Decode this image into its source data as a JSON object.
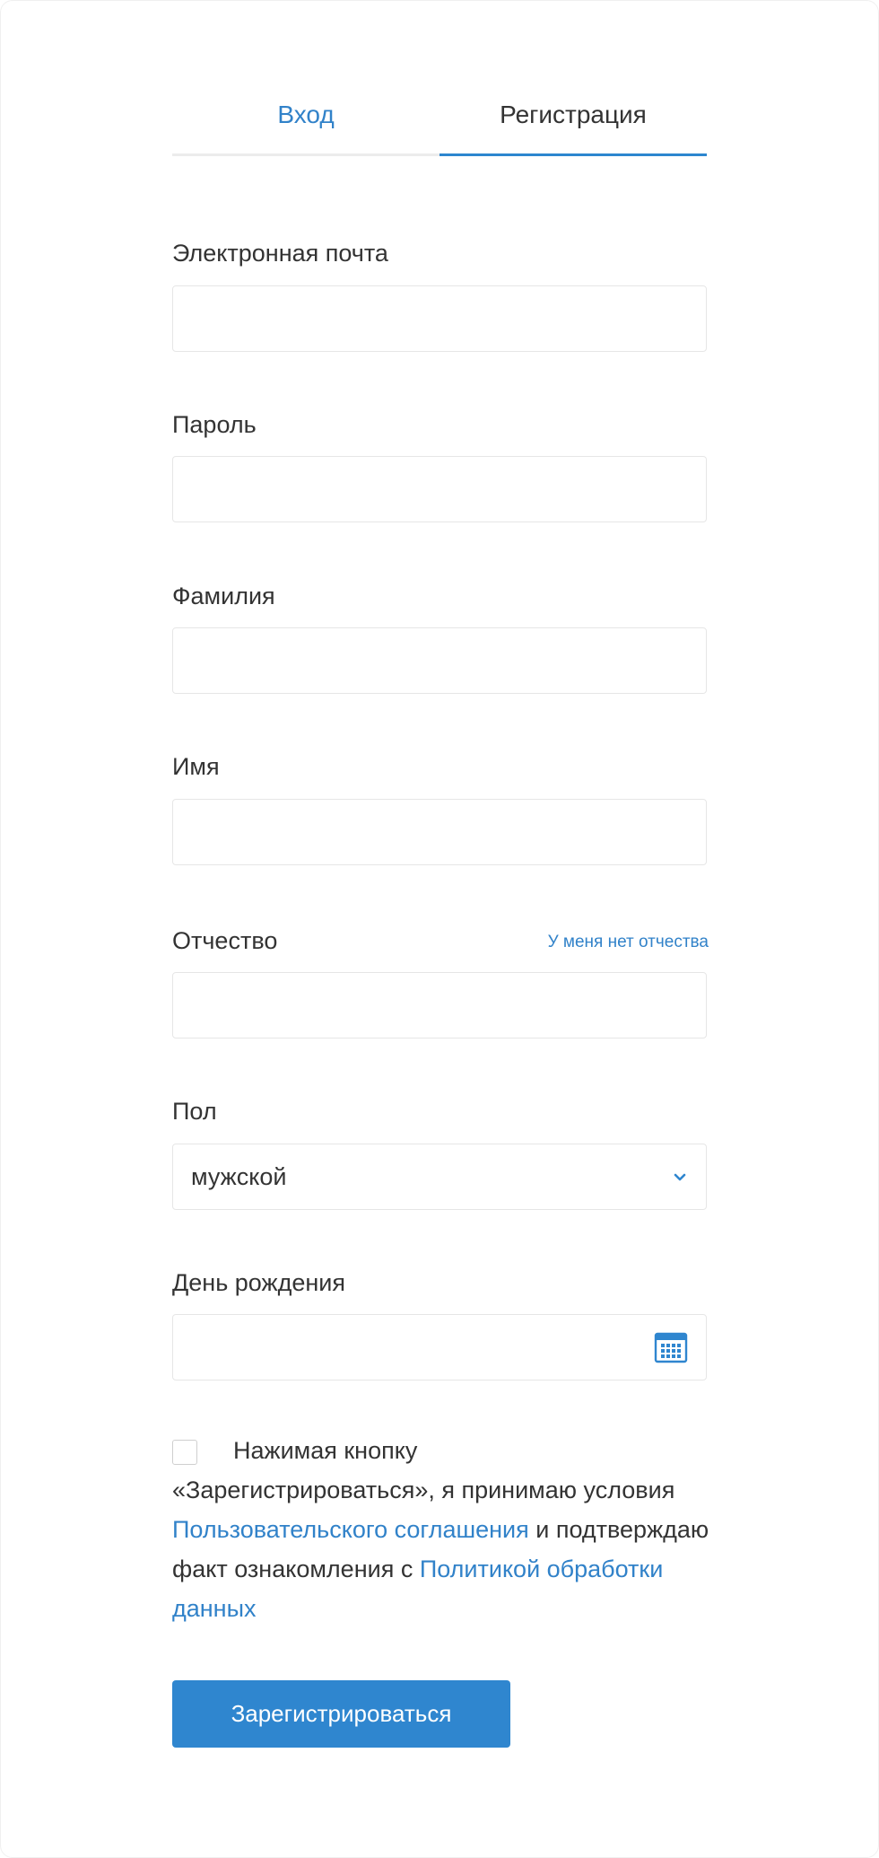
{
  "tabs": {
    "login": "Вход",
    "register": "Регистрация"
  },
  "fields": {
    "email": {
      "label": "Электронная почта",
      "value": ""
    },
    "password": {
      "label": "Пароль",
      "value": ""
    },
    "last_name": {
      "label": "Фамилия",
      "value": ""
    },
    "first_name": {
      "label": "Имя",
      "value": ""
    },
    "patronymic": {
      "label": "Отчество",
      "value": "",
      "no_patronymic_link": "У меня нет отчества"
    },
    "gender": {
      "label": "Пол",
      "selected": "мужской",
      "icon": "chevron-down-icon"
    },
    "birthday": {
      "label": "День рождения",
      "value": "",
      "icon": "calendar-icon"
    }
  },
  "agreement": {
    "checked": false,
    "text_1": "Нажимая кнопку",
    "text_2": "«Зарегистрироваться», я принимаю условия ",
    "link_terms": "Пользовательского соглашения",
    "text_3": " и подтверждаю факт ознакомления с ",
    "link_privacy": "Политикой обработки данных"
  },
  "submit_label": "Зарегистрироваться",
  "colors": {
    "accent": "#2f86cf",
    "link": "#3182c9",
    "border": "#e6e6e6",
    "text": "#333333"
  }
}
